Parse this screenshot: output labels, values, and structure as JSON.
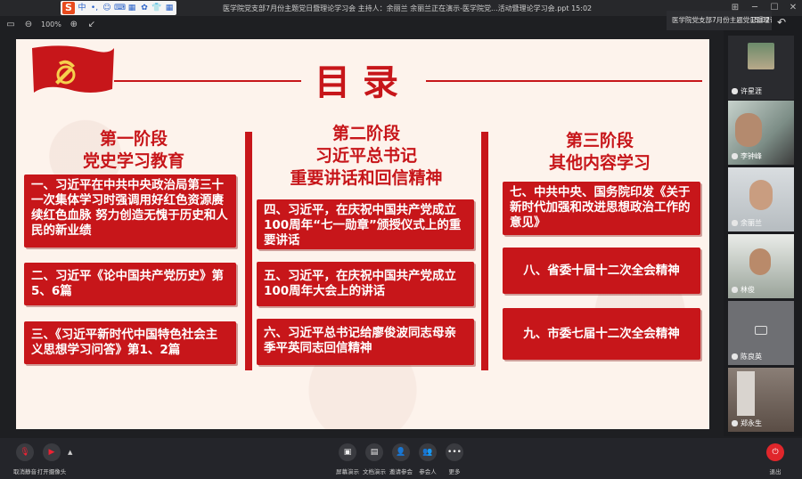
{
  "titlebar": {
    "ime_logo": "S",
    "ime_items": [
      "中",
      "•,",
      "☺",
      "⌨",
      "▦",
      "✿",
      "👕",
      "▦"
    ],
    "title": "医学院党支部7月份主题党日暨理论学习会   主持人：余丽兰   余丽兰正在演示-医学院党...活动暨理论学习会.ppt   15:02"
  },
  "toolbar": {
    "zoom": "100%"
  },
  "slide": {
    "title": "目录",
    "columns": [
      {
        "heading": [
          "第一阶段",
          "党史学习教育"
        ],
        "items": [
          "一、习近平在中共中央政治局第三十一次集体学习时强调用好红色资源赓续红色血脉 努力创造无愧于历史和人民的新业绩",
          "二、习近平《论中国共产党历史》第5、6篇",
          "三、《习近平新时代中国特色社会主义思想学习问答》第1、2篇"
        ]
      },
      {
        "heading": [
          "第二阶段",
          "习近平总书记",
          "重要讲话和回信精神"
        ],
        "items": [
          "四、习近平，在庆祝中国共产党成立100周年“七一勋章”颁授仪式上的重要讲话",
          "五、习近平，在庆祝中国共产党成立100周年大会上的讲话",
          "六、习近平总书记给廖俊波同志母亲季平英同志回信精神"
        ]
      },
      {
        "heading": [
          "第三阶段",
          "其他内容学习"
        ],
        "items": [
          "七、中共中央、国务院印发《关于新时代加强和改进思想政治工作的意见》",
          "八、省委十届十二次全会精神",
          "九、市委七届十二次全会精神"
        ]
      }
    ]
  },
  "side_panel": {
    "header": "医学院党支部7月份主题党日暨理论学习会",
    "time": "15:02",
    "participants": [
      "许星涯",
      "李钟峰",
      "余丽兰",
      "林俊",
      "陈良英",
      "郑永生"
    ]
  },
  "bottombar": {
    "left": [
      "取消静音",
      "打开摄像头"
    ],
    "center": [
      "屏幕演示",
      "文档演示",
      "邀请参会",
      "参会人",
      "更多"
    ],
    "right": "退出"
  },
  "colors": {
    "accent": "#c7161a",
    "background": "#1e1f22",
    "slide_bg": "#fdf3ec"
  }
}
